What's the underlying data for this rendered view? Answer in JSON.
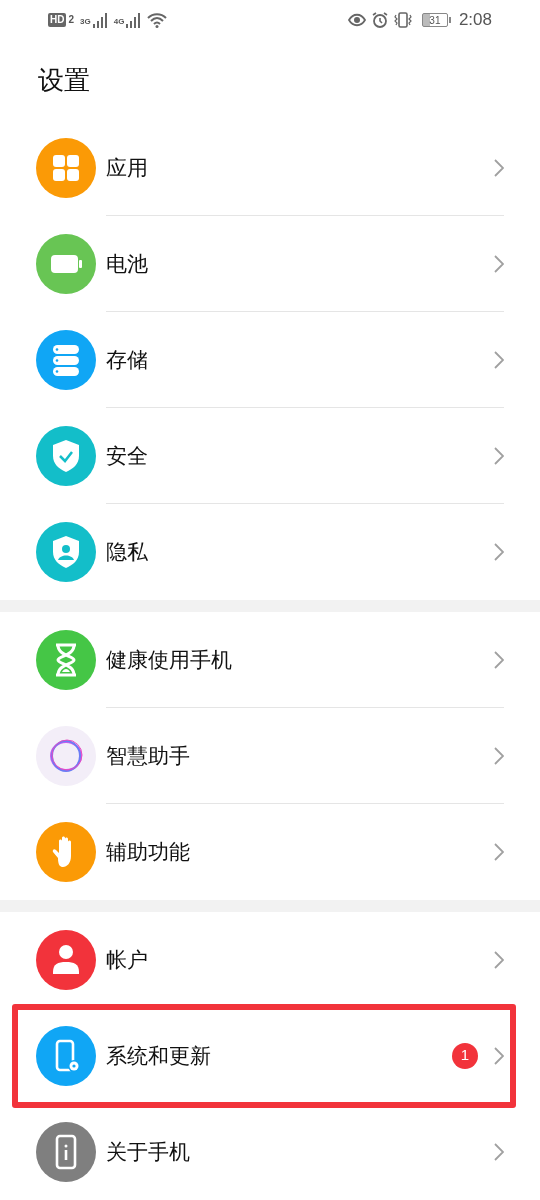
{
  "status_bar": {
    "hd": "HD",
    "sim": "2",
    "network_1": "3G",
    "network_2": "4G",
    "battery": "31",
    "time": "2:08"
  },
  "title": "设置",
  "groups": [
    {
      "items": [
        {
          "label": "应用",
          "color": "#fb9a06"
        },
        {
          "label": "电池",
          "color": "#68c554"
        },
        {
          "label": "存储",
          "color": "#10a6f5"
        },
        {
          "label": "安全",
          "color": "#13bec9"
        },
        {
          "label": "隐私",
          "color": "#13bec9"
        }
      ]
    },
    {
      "items": [
        {
          "label": "健康使用手机",
          "color": "#45c646"
        },
        {
          "label": "智慧助手",
          "color": "#f3eef8"
        },
        {
          "label": "辅助功能",
          "color": "#fb9a06"
        }
      ]
    },
    {
      "items": [
        {
          "label": "帐户",
          "color": "#f2333b"
        },
        {
          "label": "系统和更新",
          "color": "#10a6f5",
          "badge": "1",
          "highlighted": true
        },
        {
          "label": "关于手机",
          "color": "#7f7f7f"
        }
      ]
    }
  ]
}
